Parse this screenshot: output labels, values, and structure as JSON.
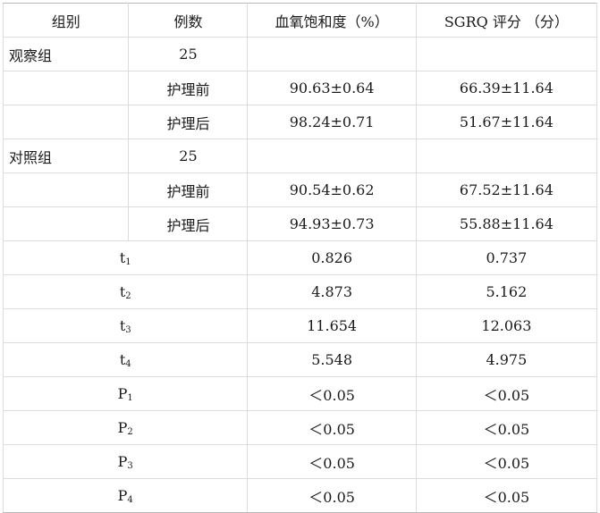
{
  "header": {
    "group": "组别",
    "count": "例数",
    "spo2": "血氧饱和度（%）",
    "sgrq": "SGRQ 评分 （分）"
  },
  "groups": [
    {
      "name": "观察组",
      "n": "25",
      "rows": [
        {
          "phase": "护理前",
          "spo2": "90.63±0.64",
          "sgrq": "66.39±11.64"
        },
        {
          "phase": "护理后",
          "spo2": "98.24±0.71",
          "sgrq": "51.67±11.64"
        }
      ]
    },
    {
      "name": "对照组",
      "n": "25",
      "rows": [
        {
          "phase": "护理前",
          "spo2": "90.54±0.62",
          "sgrq": "67.52±11.64"
        },
        {
          "phase": "护理后",
          "spo2": "94.93±0.73",
          "sgrq": "55.88±11.64"
        }
      ]
    }
  ],
  "stats": [
    {
      "sym": "t",
      "sub": "1",
      "spo2": "0.826",
      "sgrq": "0.737"
    },
    {
      "sym": "t",
      "sub": "2",
      "spo2": "4.873",
      "sgrq": "5.162"
    },
    {
      "sym": "t",
      "sub": "3",
      "spo2": "11.654",
      "sgrq": "12.063"
    },
    {
      "sym": "t",
      "sub": "4",
      "spo2": "5.548",
      "sgrq": "4.975"
    },
    {
      "sym": "P",
      "sub": "1",
      "spo2": "＜0.05",
      "sgrq": "＜0.05"
    },
    {
      "sym": "P",
      "sub": "2",
      "spo2": "＜0.05",
      "sgrq": "＜0.05"
    },
    {
      "sym": "P",
      "sub": "3",
      "spo2": "＜0.05",
      "sgrq": "＜0.05"
    },
    {
      "sym": "P",
      "sub": "4",
      "spo2": "＜0.05",
      "sgrq": "＜0.05"
    }
  ]
}
